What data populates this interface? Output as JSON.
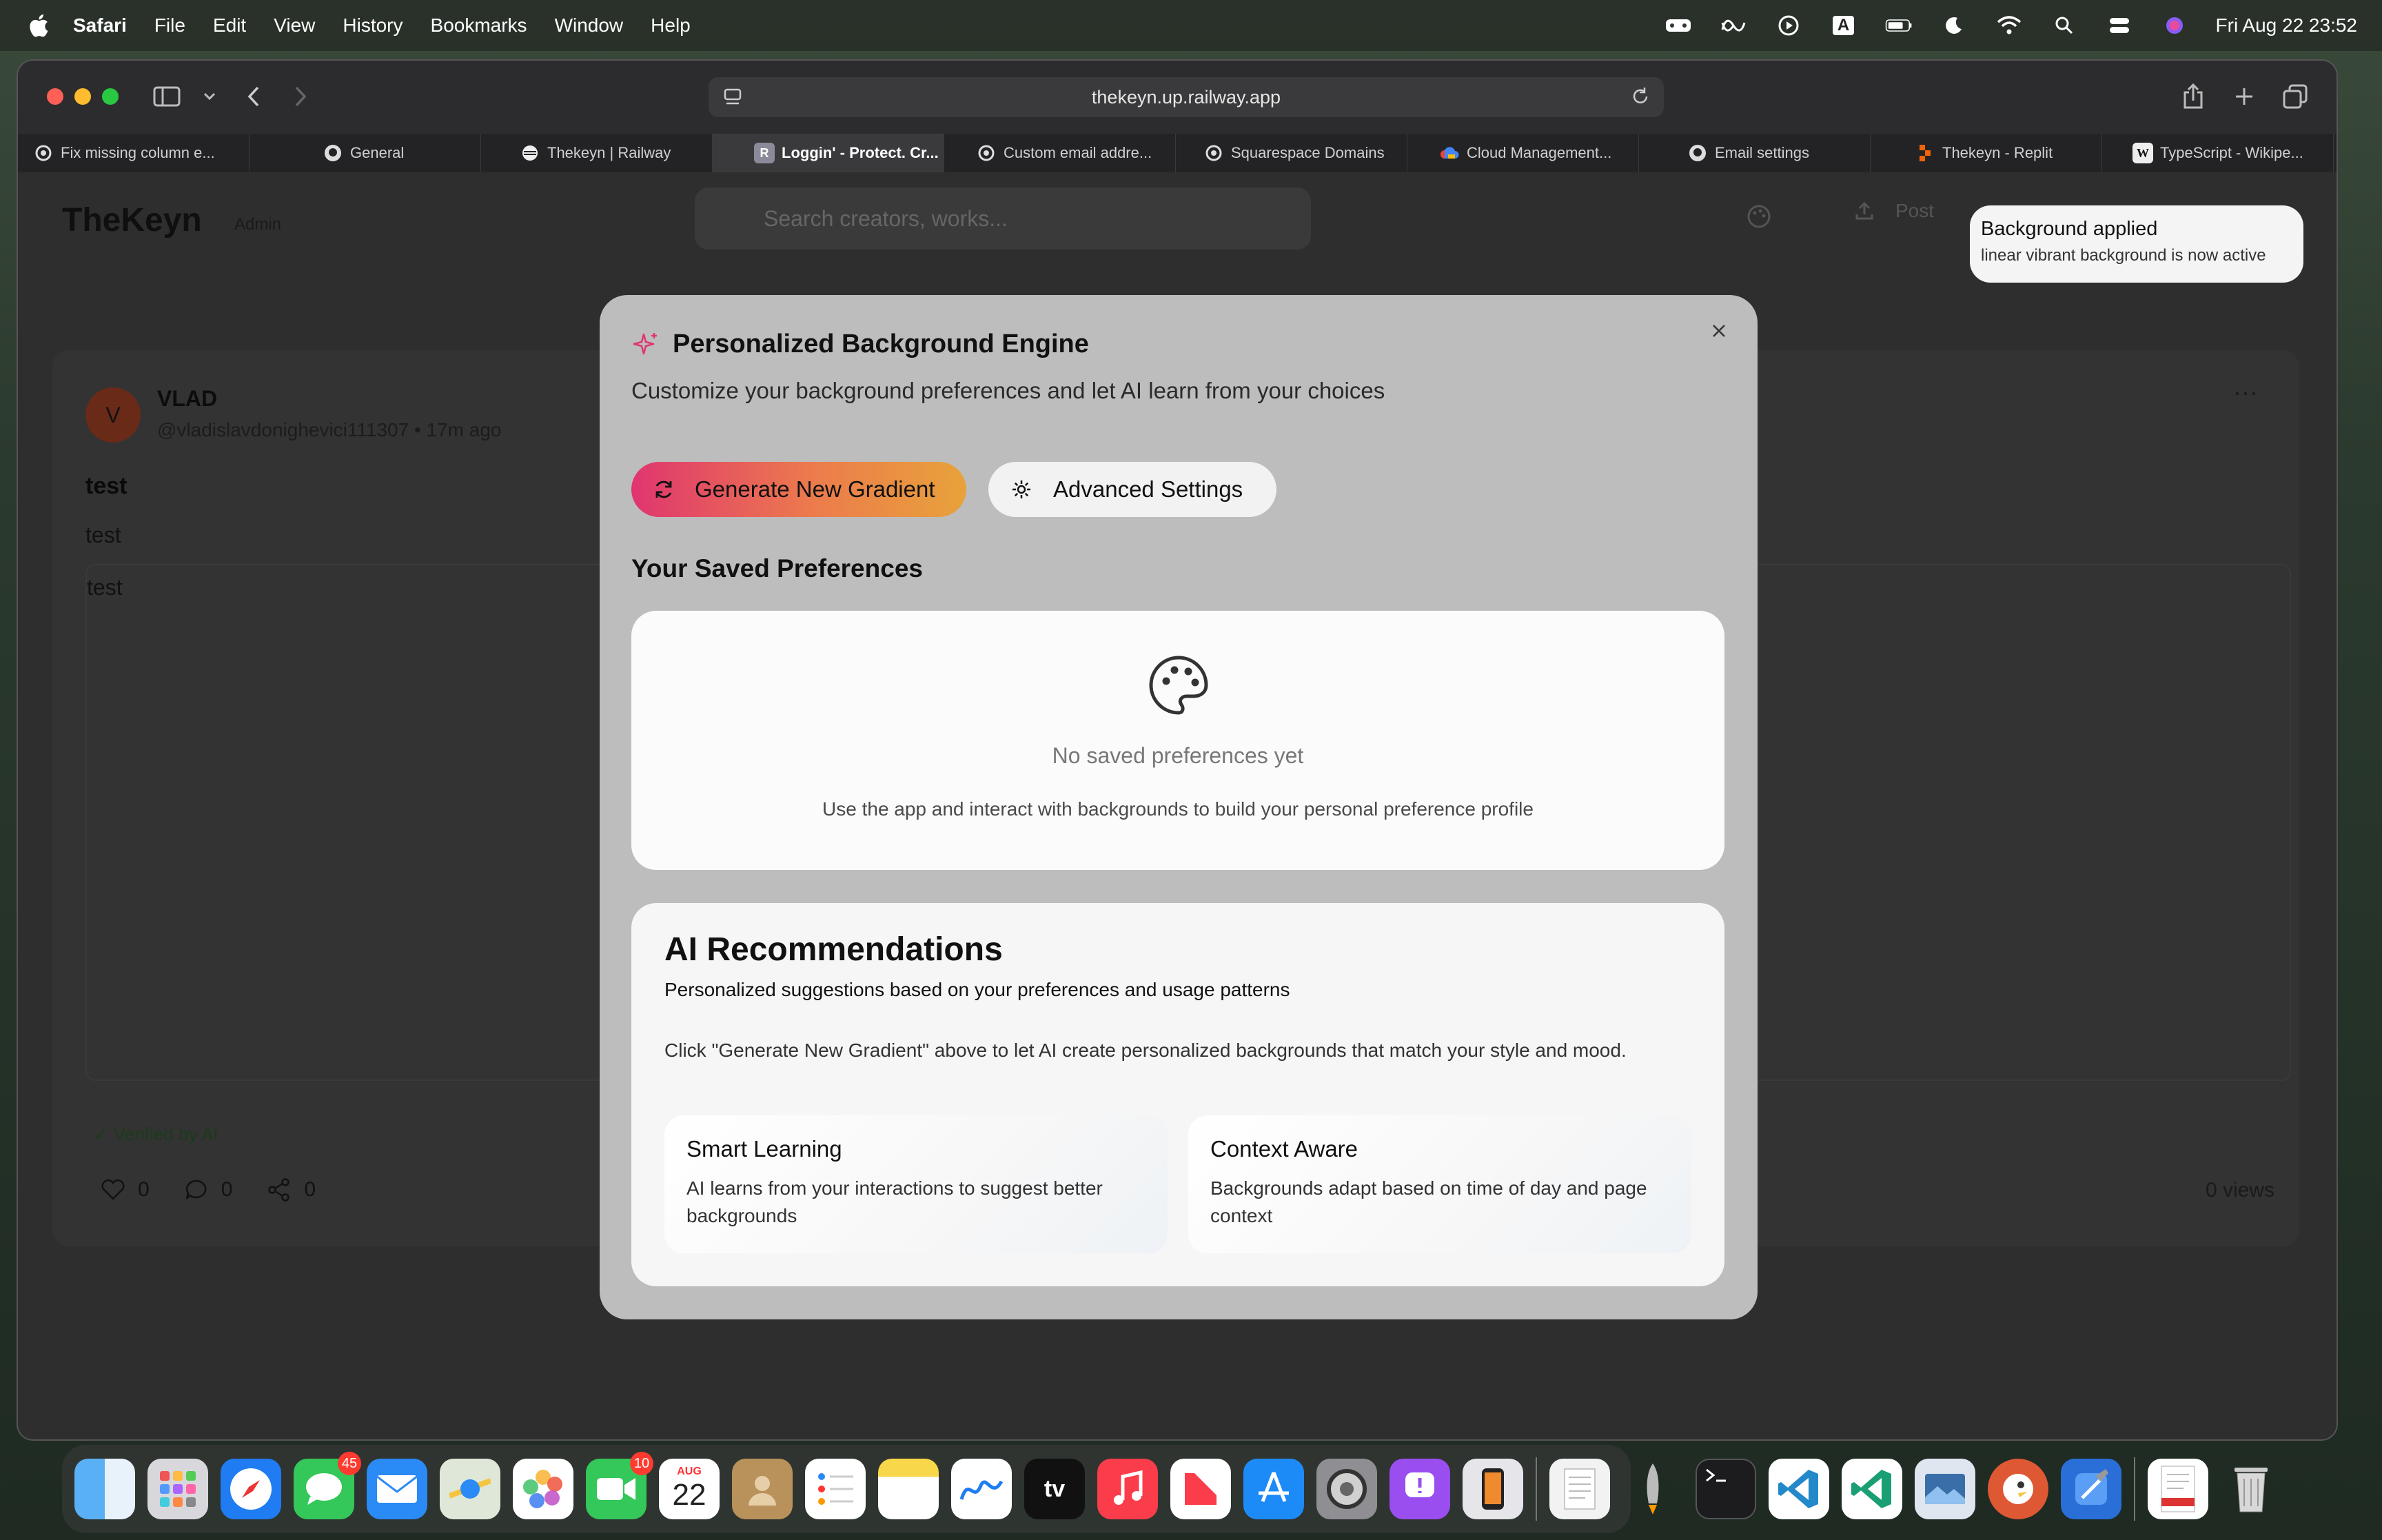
{
  "menubar": {
    "app_name": "Safari",
    "menus": [
      "File",
      "Edit",
      "View",
      "History",
      "Bookmarks",
      "Window",
      "Help"
    ],
    "clock": "Fri Aug 22  23:52",
    "input_source": "A"
  },
  "browser": {
    "url": "thekeyn.up.railway.app",
    "tabs": [
      {
        "label": "Fix missing column e...",
        "icon": "openai-icon",
        "active": false
      },
      {
        "label": "General",
        "icon": "github-icon",
        "active": false
      },
      {
        "label": "Thekeyn | Railway",
        "icon": "railway-icon",
        "active": false
      },
      {
        "label": "Loggin' - Protect. Cr...",
        "icon": "r-icon",
        "active": true
      },
      {
        "label": "Custom email addre...",
        "icon": "openai-icon",
        "active": false
      },
      {
        "label": "Squarespace Domains",
        "icon": "openai-icon",
        "active": false
      },
      {
        "label": "Cloud Management...",
        "icon": "google-cloud-icon",
        "active": false
      },
      {
        "label": "Email settings",
        "icon": "github-icon",
        "active": false
      },
      {
        "label": "Thekeyn - Replit",
        "icon": "replit-icon",
        "active": false
      },
      {
        "label": "TypeScript - Wikipe...",
        "icon": "wikipedia-icon",
        "active": false
      }
    ],
    "tab_initial": "R",
    "wiki_initial": "W"
  },
  "site": {
    "title": "TheKeyn",
    "role_badge": "Admin",
    "search_placeholder": "Search creators, works...",
    "post_label": "Post"
  },
  "post": {
    "avatar_initial": "V",
    "author": "VLAD",
    "handle": "@vladislavdonighevici111307 • 17m ago",
    "title": "test",
    "subtitle": "test",
    "body": "test",
    "verified": "✓ Verified by AI",
    "likes": "0",
    "comments": "0",
    "shares": "0",
    "views": "0 views",
    "more": "···"
  },
  "toast": {
    "title": "Background applied",
    "message": "linear vibrant background is now active"
  },
  "modal": {
    "title": "Personalized Background Engine",
    "subtitle": "Customize your background preferences and let AI learn from your choices",
    "generate_label": "Generate New Gradient",
    "advanced_label": "Advanced Settings",
    "saved_heading": "Your Saved Preferences",
    "empty_title": "No saved preferences yet",
    "empty_sub": "Use the app and interact with backgrounds to build your personal preference profile",
    "ai": {
      "title": "AI Recommendations",
      "subtitle": "Personalized suggestions based on your preferences and usage patterns",
      "description": "Click \"Generate New Gradient\" above to let AI create personalized backgrounds that match your style and mood.",
      "features": [
        {
          "title": "Smart Learning",
          "description": "AI learns from your interactions to suggest better backgrounds"
        },
        {
          "title": "Context Aware",
          "description": "Backgrounds adapt based on time of day and page context"
        }
      ]
    }
  },
  "dock": {
    "messages_badge": "45",
    "facetime_badge": "10",
    "calendar_month": "AUG",
    "calendar_day": "22",
    "tv_label": "tv"
  },
  "colors": {
    "accent_gradient": [
      "#e0356f",
      "#ec7c4c",
      "#e8a23a"
    ],
    "sparkle": "#e0356f"
  }
}
